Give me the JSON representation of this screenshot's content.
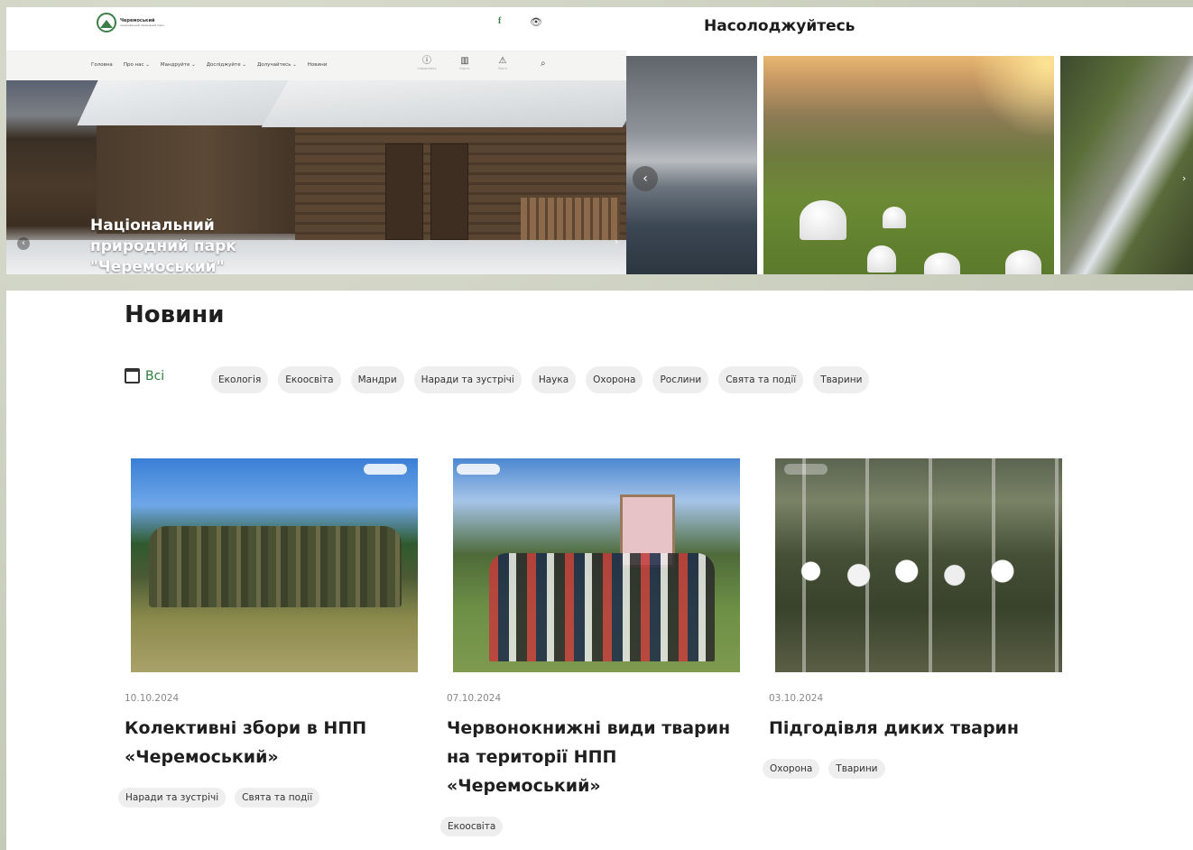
{
  "header": {
    "logo": {
      "name": "Черемоський",
      "subtitle": "національний природний парк"
    },
    "social": {
      "facebook": "f",
      "vision": "👁"
    },
    "nav": [
      "Головна",
      "Про нас ⌄",
      "Мандруйте ⌄",
      "Досліджуйте ⌄",
      "Долучайтесь ⌄",
      "Новини"
    ],
    "tools": [
      {
        "icon": "info-icon",
        "glyph": "ⓘ",
        "label": "Інформація"
      },
      {
        "icon": "map-icon",
        "glyph": "▥",
        "label": "Карти"
      },
      {
        "icon": "warning-icon",
        "glyph": "⚠",
        "label": "Увага"
      }
    ],
    "search_glyph": "⌕"
  },
  "hero": {
    "title": "Національний природний парк \"Черемоський\"",
    "arrow_left": "‹",
    "arrow_right": "›"
  },
  "enjoy": {
    "title": "Насолоджуйтесь",
    "arrow_left": "‹",
    "arrow_right": "›"
  },
  "news": {
    "title": "Новини",
    "all_label": "Всі",
    "categories": [
      "Екологія",
      "Екоосвіта",
      "Мандри",
      "Наради та зустрічі",
      "Наука",
      "Охорона",
      "Рослини",
      "Свята та події",
      "Тварини"
    ],
    "articles": [
      {
        "date": "10.10.2024",
        "title": "Колективні збори в НПП «Черемоський»",
        "tags": [
          "Наради та зустрічі",
          "Свята та події"
        ]
      },
      {
        "date": "07.10.2024",
        "title": "Червонокнижні види тварин на території НПП «Черемоський»",
        "tags": [
          "Екоосвіта"
        ]
      },
      {
        "date": "03.10.2024",
        "title": "Підгодівля диких тварин",
        "tags": [
          "Охорона",
          "Тварини"
        ]
      }
    ]
  }
}
